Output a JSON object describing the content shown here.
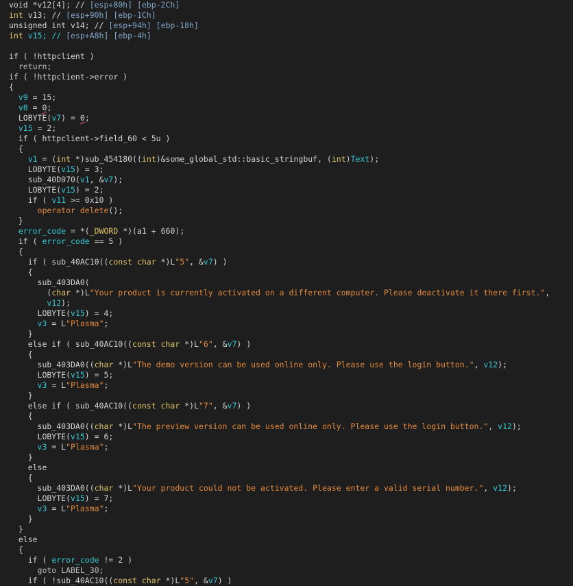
{
  "lines": [
    [
      {
        "t": "void *v12[4]; // ",
        "c": "text"
      },
      {
        "t": "[esp+80h] [ebp-2Ch]",
        "c": "comment"
      }
    ],
    [
      {
        "t": "int ",
        "c": "type"
      },
      {
        "t": "v13; // ",
        "c": "text"
      },
      {
        "t": "[esp+90h] [ebp-1Ch]",
        "c": "comment"
      }
    ],
    [
      {
        "t": "unsigned int ",
        "c": "text"
      },
      {
        "t": "v14; // ",
        "c": "text"
      },
      {
        "t": "[esp+94h] [ebp-18h]",
        "c": "comment"
      }
    ],
    [
      {
        "t": "int ",
        "c": "type"
      },
      {
        "t": "v15; // ",
        "c": "var"
      },
      {
        "t": "[esp+A8h] [ebp-4h]",
        "c": "comment"
      }
    ],
    [],
    [
      {
        "t": "if ( !httpclient )",
        "c": "text"
      }
    ],
    [
      {
        "t": "  return;",
        "c": "gray"
      }
    ],
    [
      {
        "t": "if ( !httpclient->error )",
        "c": "text"
      }
    ],
    [
      {
        "t": "{",
        "c": "text"
      }
    ],
    [
      {
        "t": "  ",
        "c": "text"
      },
      {
        "t": "v9",
        "c": "var"
      },
      {
        "t": " = 15;",
        "c": "text"
      }
    ],
    [
      {
        "t": "  ",
        "c": "text"
      },
      {
        "t": "v8",
        "c": "var"
      },
      {
        "t": " = ",
        "c": "text"
      },
      {
        "t": "0",
        "c": "mark"
      },
      {
        "t": ";",
        "c": "text"
      }
    ],
    [
      {
        "t": "  LOBYTE(",
        "c": "text"
      },
      {
        "t": "v7",
        "c": "var"
      },
      {
        "t": ") = ",
        "c": "text"
      },
      {
        "t": "0",
        "c": "mark"
      },
      {
        "t": ";",
        "c": "text"
      }
    ],
    [
      {
        "t": "  ",
        "c": "text"
      },
      {
        "t": "v15",
        "c": "var"
      },
      {
        "t": " = 2;",
        "c": "text"
      }
    ],
    [
      {
        "t": "  if ( httpclient->field_60 < 5u )",
        "c": "text"
      }
    ],
    [
      {
        "t": "  {",
        "c": "text"
      }
    ],
    [
      {
        "t": "    ",
        "c": "text"
      },
      {
        "t": "v1",
        "c": "var"
      },
      {
        "t": " = (",
        "c": "text"
      },
      {
        "t": "int",
        "c": "type"
      },
      {
        "t": " *)sub_454180((",
        "c": "text"
      },
      {
        "t": "int",
        "c": "type"
      },
      {
        "t": ")&some_global_std::basic_stringbuf, (",
        "c": "text"
      },
      {
        "t": "int",
        "c": "type"
      },
      {
        "t": ")",
        "c": "text"
      },
      {
        "t": "Text",
        "c": "var"
      },
      {
        "t": ");",
        "c": "text"
      }
    ],
    [
      {
        "t": "    LOBYTE(",
        "c": "text"
      },
      {
        "t": "v15",
        "c": "var"
      },
      {
        "t": ") = 3;",
        "c": "text"
      }
    ],
    [
      {
        "t": "    sub_40D070(",
        "c": "text"
      },
      {
        "t": "v1",
        "c": "var"
      },
      {
        "t": ", &",
        "c": "text"
      },
      {
        "t": "v7",
        "c": "var"
      },
      {
        "t": ");",
        "c": "text"
      }
    ],
    [
      {
        "t": "    LOBYTE(",
        "c": "text"
      },
      {
        "t": "v15",
        "c": "var"
      },
      {
        "t": ") = 2;",
        "c": "text"
      }
    ],
    [
      {
        "t": "    if ( ",
        "c": "text"
      },
      {
        "t": "v11",
        "c": "var"
      },
      {
        "t": " >= 0x10 )",
        "c": "text"
      }
    ],
    [
      {
        "t": "      ",
        "c": "text"
      },
      {
        "t": "operator delete",
        "c": "str"
      },
      {
        "t": "();",
        "c": "text"
      }
    ],
    [
      {
        "t": "  }",
        "c": "text"
      }
    ],
    [
      {
        "t": "  ",
        "c": "text"
      },
      {
        "t": "error_code",
        "c": "var"
      },
      {
        "t": " = *(",
        "c": "text"
      },
      {
        "t": "_DWORD",
        "c": "type"
      },
      {
        "t": " *)(a1 + 660);",
        "c": "text"
      }
    ],
    [
      {
        "t": "  if ( ",
        "c": "text"
      },
      {
        "t": "error_code",
        "c": "var"
      },
      {
        "t": " == 5 )",
        "c": "text"
      }
    ],
    [
      {
        "t": "  {",
        "c": "text"
      }
    ],
    [
      {
        "t": "    if ( sub_40AC10((",
        "c": "text"
      },
      {
        "t": "const char",
        "c": "type"
      },
      {
        "t": " *)L",
        "c": "text"
      },
      {
        "t": "\"5\"",
        "c": "str"
      },
      {
        "t": ", &",
        "c": "text"
      },
      {
        "t": "v7",
        "c": "var"
      },
      {
        "t": ") )",
        "c": "text"
      }
    ],
    [
      {
        "t": "    {",
        "c": "text"
      }
    ],
    [
      {
        "t": "      sub_403DA0(",
        "c": "text"
      }
    ],
    [
      {
        "t": "        (",
        "c": "text"
      },
      {
        "t": "char",
        "c": "type"
      },
      {
        "t": " *)L",
        "c": "text"
      },
      {
        "t": "\"Your product is currently activated on a different computer. Please deactivate it there first.\"",
        "c": "str"
      },
      {
        "t": ",",
        "c": "text"
      }
    ],
    [
      {
        "t": "        ",
        "c": "text"
      },
      {
        "t": "v12",
        "c": "var"
      },
      {
        "t": ");",
        "c": "text"
      }
    ],
    [
      {
        "t": "      LOBYTE(",
        "c": "text"
      },
      {
        "t": "v15",
        "c": "var"
      },
      {
        "t": ") = 4;",
        "c": "text"
      }
    ],
    [
      {
        "t": "      ",
        "c": "text"
      },
      {
        "t": "v3",
        "c": "var"
      },
      {
        "t": " = L",
        "c": "text"
      },
      {
        "t": "\"Plasma\"",
        "c": "str"
      },
      {
        "t": ";",
        "c": "text"
      }
    ],
    [
      {
        "t": "    }",
        "c": "text"
      }
    ],
    [
      {
        "t": "    else if ( sub_40AC10((",
        "c": "text"
      },
      {
        "t": "const char",
        "c": "type"
      },
      {
        "t": " *)L",
        "c": "text"
      },
      {
        "t": "\"6\"",
        "c": "str"
      },
      {
        "t": ", &",
        "c": "text"
      },
      {
        "t": "v7",
        "c": "var"
      },
      {
        "t": ") )",
        "c": "text"
      }
    ],
    [
      {
        "t": "    {",
        "c": "text"
      }
    ],
    [
      {
        "t": "      sub_403DA0((",
        "c": "text"
      },
      {
        "t": "char",
        "c": "type"
      },
      {
        "t": " *)L",
        "c": "text"
      },
      {
        "t": "\"The demo version can be used online only. Please use the login button.\"",
        "c": "str"
      },
      {
        "t": ", ",
        "c": "text"
      },
      {
        "t": "v12",
        "c": "var"
      },
      {
        "t": ");",
        "c": "text"
      }
    ],
    [
      {
        "t": "      LOBYTE(",
        "c": "text"
      },
      {
        "t": "v15",
        "c": "var"
      },
      {
        "t": ") = 5;",
        "c": "text"
      }
    ],
    [
      {
        "t": "      ",
        "c": "text"
      },
      {
        "t": "v3",
        "c": "var"
      },
      {
        "t": " = L",
        "c": "text"
      },
      {
        "t": "\"Plasma\"",
        "c": "str"
      },
      {
        "t": ";",
        "c": "text"
      }
    ],
    [
      {
        "t": "    }",
        "c": "text"
      }
    ],
    [
      {
        "t": "    else if ( sub_40AC10((",
        "c": "text"
      },
      {
        "t": "const char",
        "c": "type"
      },
      {
        "t": " *)L",
        "c": "text"
      },
      {
        "t": "\"7\"",
        "c": "str"
      },
      {
        "t": ", &",
        "c": "text"
      },
      {
        "t": "v7",
        "c": "var"
      },
      {
        "t": ") )",
        "c": "text"
      }
    ],
    [
      {
        "t": "    {",
        "c": "text"
      }
    ],
    [
      {
        "t": "      sub_403DA0((",
        "c": "text"
      },
      {
        "t": "char",
        "c": "type"
      },
      {
        "t": " *)L",
        "c": "text"
      },
      {
        "t": "\"The preview version can be used online only. Please use the login button.\"",
        "c": "str"
      },
      {
        "t": ", ",
        "c": "text"
      },
      {
        "t": "v12",
        "c": "var"
      },
      {
        "t": ");",
        "c": "text"
      }
    ],
    [
      {
        "t": "      LOBYTE(",
        "c": "text"
      },
      {
        "t": "v15",
        "c": "var"
      },
      {
        "t": ") = 6;",
        "c": "text"
      }
    ],
    [
      {
        "t": "      ",
        "c": "text"
      },
      {
        "t": "v3",
        "c": "var"
      },
      {
        "t": " = L",
        "c": "text"
      },
      {
        "t": "\"Plasma\"",
        "c": "str"
      },
      {
        "t": ";",
        "c": "text"
      }
    ],
    [
      {
        "t": "    }",
        "c": "text"
      }
    ],
    [
      {
        "t": "    else",
        "c": "text"
      }
    ],
    [
      {
        "t": "    {",
        "c": "text"
      }
    ],
    [
      {
        "t": "      sub_403DA0((",
        "c": "text"
      },
      {
        "t": "char",
        "c": "type"
      },
      {
        "t": " *)L",
        "c": "text"
      },
      {
        "t": "\"Your product could not be activated. Please enter a valid serial number.\"",
        "c": "str"
      },
      {
        "t": ", ",
        "c": "text"
      },
      {
        "t": "v12",
        "c": "var"
      },
      {
        "t": ");",
        "c": "text"
      }
    ],
    [
      {
        "t": "      LOBYTE(",
        "c": "text"
      },
      {
        "t": "v15",
        "c": "var"
      },
      {
        "t": ") = 7;",
        "c": "text"
      }
    ],
    [
      {
        "t": "      ",
        "c": "text"
      },
      {
        "t": "v3",
        "c": "var"
      },
      {
        "t": " = L",
        "c": "text"
      },
      {
        "t": "\"Plasma\"",
        "c": "str"
      },
      {
        "t": ";",
        "c": "text"
      }
    ],
    [
      {
        "t": "    }",
        "c": "text"
      }
    ],
    [
      {
        "t": "  }",
        "c": "text"
      }
    ],
    [
      {
        "t": "  else",
        "c": "text"
      }
    ],
    [
      {
        "t": "  {",
        "c": "text"
      }
    ],
    [
      {
        "t": "    if ( ",
        "c": "text"
      },
      {
        "t": "error_code",
        "c": "var"
      },
      {
        "t": " != 2 )",
        "c": "text"
      }
    ],
    [
      {
        "t": "      goto LABEL_30;",
        "c": "gray"
      }
    ],
    [
      {
        "t": "    if ( !sub_40AC10((",
        "c": "text"
      },
      {
        "t": "const char",
        "c": "type"
      },
      {
        "t": " *)L",
        "c": "text"
      },
      {
        "t": "\"5\"",
        "c": "str"
      },
      {
        "t": ", &",
        "c": "text"
      },
      {
        "t": "v7",
        "c": "var"
      },
      {
        "t": ") )",
        "c": "text"
      }
    ]
  ],
  "colors": {
    "background": "#1e1e1e",
    "text": "#d4d4d4",
    "type": "#e0c667",
    "var": "#34c9d6",
    "str": "#e48a3b",
    "comment": "#7fa5c9",
    "gray": "#bdbdbd"
  }
}
